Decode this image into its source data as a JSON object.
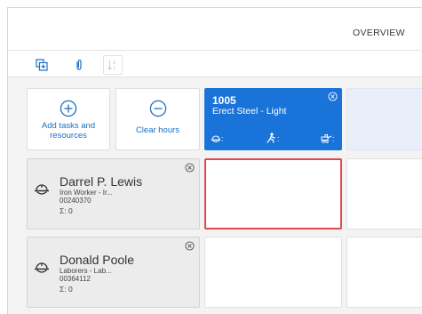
{
  "header": {
    "tab_overview": "OVERVIEW"
  },
  "toolbar": {
    "buttons": [
      {
        "name": "add-layers-icon"
      },
      {
        "name": "paperclip-icon"
      },
      {
        "name": "sort-az-icon"
      }
    ]
  },
  "actions": {
    "add_tasks_label": "Add tasks and resources",
    "clear_hours_label": "Clear hours"
  },
  "task": {
    "id": "1005",
    "name": "Erect Steel - Light",
    "stats": [
      {
        "icon": "hardhat-icon",
        "value": ":"
      },
      {
        "icon": "worker-icon",
        "value": ":"
      },
      {
        "icon": "equipment-icon",
        "value": ":"
      }
    ],
    "color": "#1a73d9"
  },
  "resources": [
    {
      "name": "Darrel P. Lewis",
      "role": "Iron Worker - Ir...",
      "code": "00240370",
      "sum": "Σ: 0"
    },
    {
      "name": "Donald Poole",
      "role": "Laborers - Lab...",
      "code": "00364112",
      "sum": "Σ: 0"
    }
  ],
  "colors": {
    "accent": "#1a73d9",
    "selected_border": "#e0484f",
    "link": "#1a6fc4"
  }
}
